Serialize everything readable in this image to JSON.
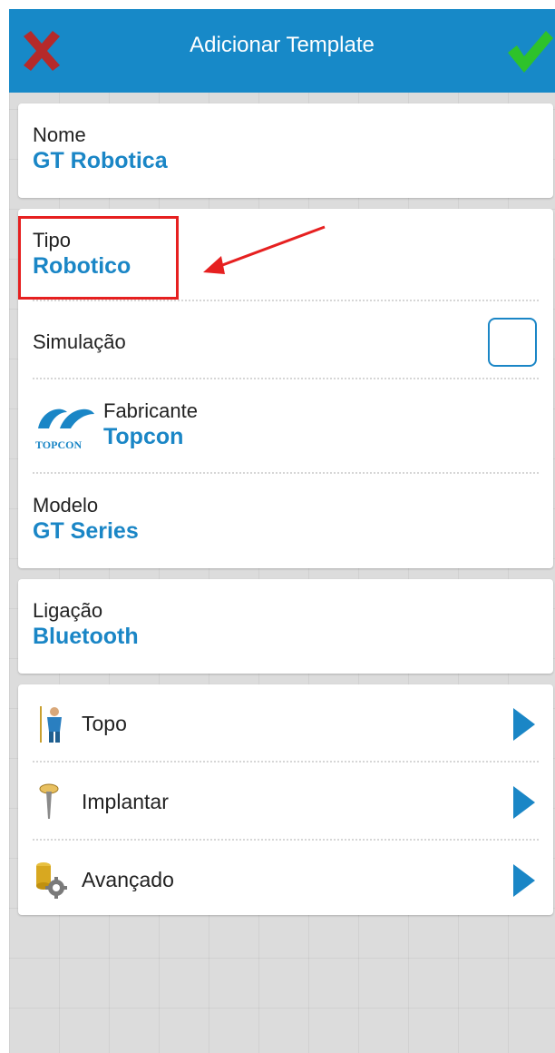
{
  "header": {
    "title": "Adicionar Template",
    "cancel_icon": "close-icon",
    "confirm_icon": "checkmark-icon"
  },
  "name_card": {
    "label": "Nome",
    "value": "GT Robotica"
  },
  "device_card": {
    "tipo": {
      "label": "Tipo",
      "value": "Robotico"
    },
    "simulacao": {
      "label": "Simulação",
      "checked": false
    },
    "fabricante": {
      "label": "Fabricante",
      "value": "Topcon",
      "logo_text": "TOPCON"
    },
    "modelo": {
      "label": "Modelo",
      "value": "GT Series"
    }
  },
  "connection_card": {
    "label": "Ligação",
    "value": "Bluetooth"
  },
  "menu": {
    "items": [
      {
        "label": "Topo",
        "icon": "surveyor-icon"
      },
      {
        "label": "Implantar",
        "icon": "stake-pin-icon"
      },
      {
        "label": "Avançado",
        "icon": "advanced-settings-icon"
      }
    ]
  },
  "colors": {
    "header_bg": "#1789c8",
    "value_text": "#1a86c6",
    "annotation": "#e62020"
  }
}
